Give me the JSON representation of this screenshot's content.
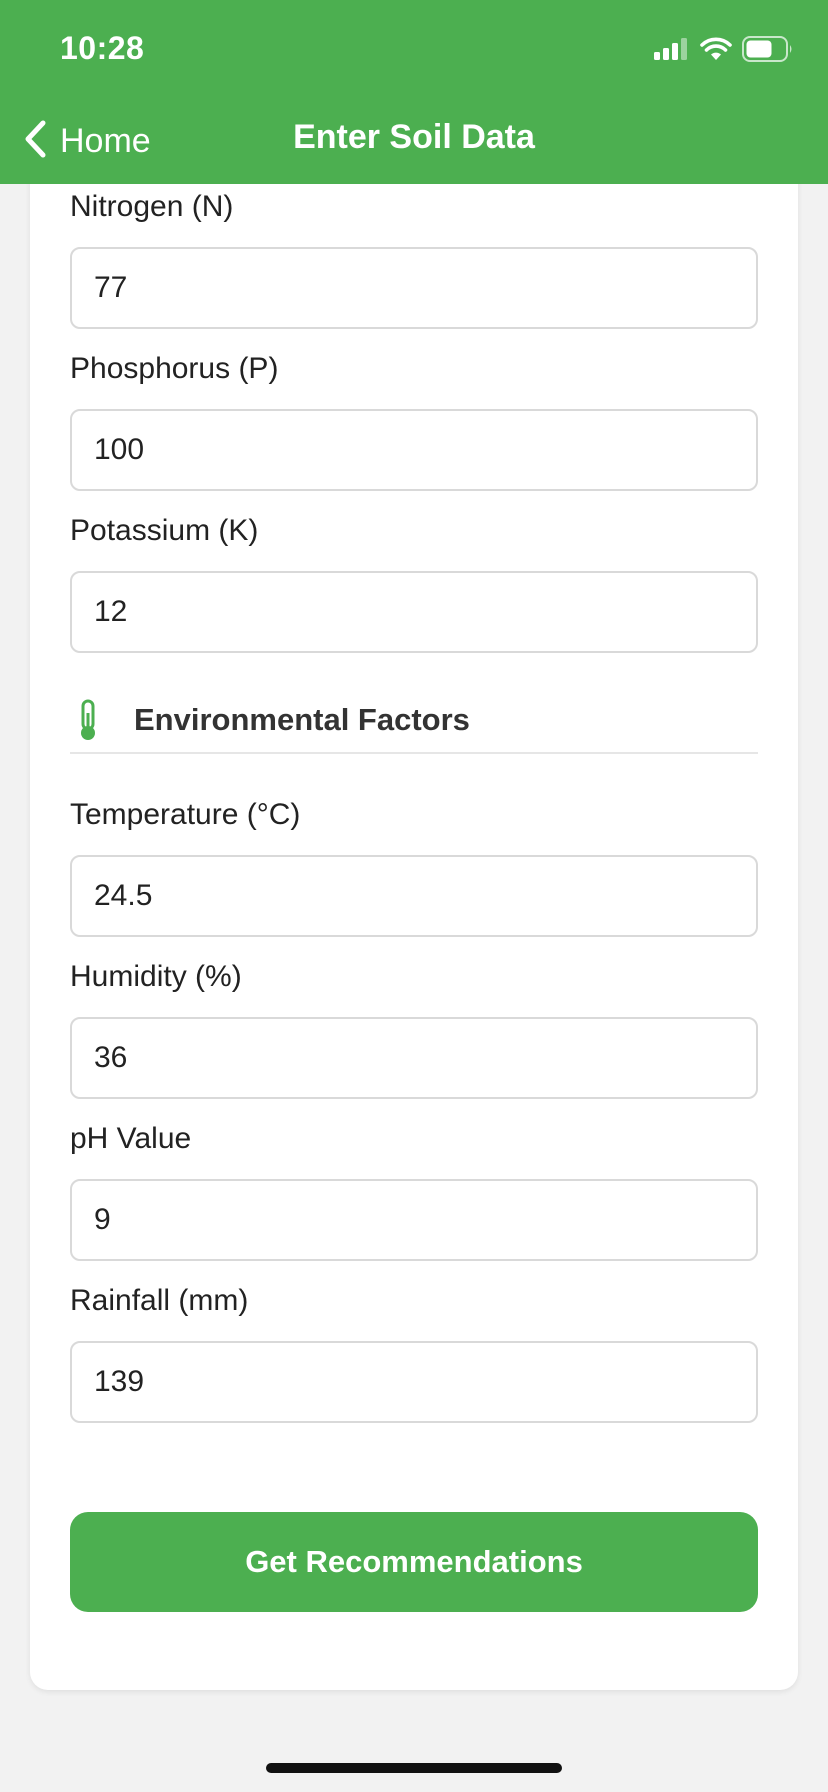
{
  "status_bar": {
    "time": "10:28",
    "icons": [
      "cellular-signal-icon",
      "wifi-icon",
      "battery-icon"
    ]
  },
  "nav": {
    "back_label": "Home",
    "title": "Enter Soil Data"
  },
  "fields_top": [
    {
      "label": "Nitrogen (N)",
      "value": "77"
    },
    {
      "label": "Phosphorus (P)",
      "value": "100"
    },
    {
      "label": "Potassium (K)",
      "value": "12"
    }
  ],
  "section": {
    "title": "Environmental Factors",
    "icon": "thermometer-icon"
  },
  "fields_env": [
    {
      "label": "Temperature (°C)",
      "value": "24.5"
    },
    {
      "label": "Humidity (%)",
      "value": "36"
    },
    {
      "label": "pH Value",
      "value": "9"
    },
    {
      "label": "Rainfall (mm)",
      "value": "139"
    }
  ],
  "cta": {
    "label": "Get Recommendations"
  },
  "colors": {
    "accent": "#4caf50",
    "background": "#f2f2f2",
    "card": "#ffffff"
  }
}
